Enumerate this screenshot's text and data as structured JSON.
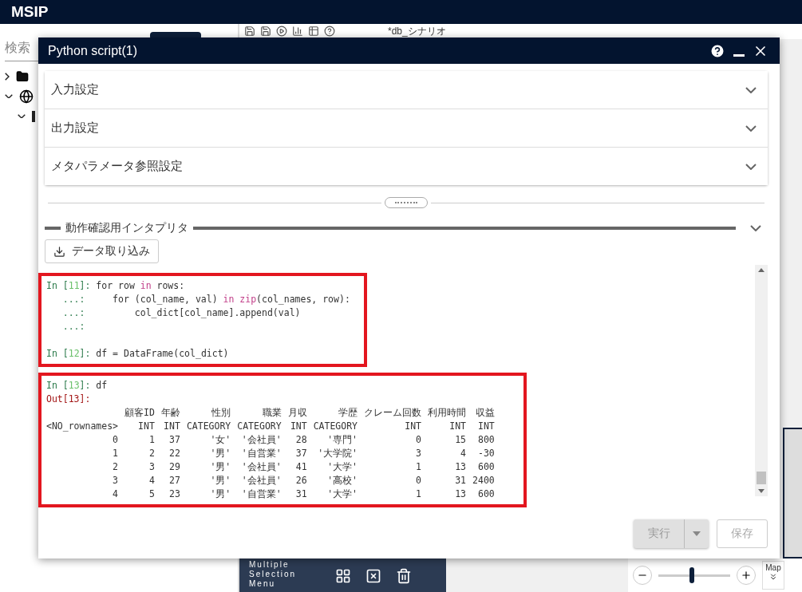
{
  "app": {
    "title": "MSIP"
  },
  "sidebar": {
    "search_label": "検索",
    "tree": [
      {
        "kind": "folder",
        "expanded": false
      },
      {
        "kind": "globe",
        "expanded": true,
        "children": [
          {
            "kind": "item",
            "expanded": true
          }
        ]
      }
    ]
  },
  "editor_tab": {
    "label": "*db_シナリオ"
  },
  "dialog": {
    "title": "Python script(1)",
    "sections": [
      {
        "label": "入力設定",
        "expanded": false
      },
      {
        "label": "出力設定",
        "expanded": false
      },
      {
        "label": "メタパラメータ参照設定",
        "expanded": false
      }
    ],
    "interpreter": {
      "title": "動作確認用インタプリタ",
      "import_button": "データ取り込み",
      "cells": [
        {
          "entries": [
            [
              [
                {
                  "text": "In [",
                  "kind": "prompt"
                },
                {
                  "text": "11",
                  "kind": "number"
                },
                {
                  "text": "]: ",
                  "kind": "prompt"
                },
                {
                  "text": "for row ",
                  "kind": "code"
                },
                {
                  "text": "in",
                  "kind": "keyword"
                },
                {
                  "text": " rows:",
                  "kind": "code"
                }
              ],
              [
                {
                  "text": "   ...: ",
                  "kind": "prompt"
                },
                {
                  "text": "    for (col_name, val) ",
                  "kind": "code"
                },
                {
                  "text": "in zip",
                  "kind": "keyword"
                },
                {
                  "text": "(col_names, row):",
                  "kind": "code"
                }
              ],
              [
                {
                  "text": "   ...: ",
                  "kind": "prompt"
                },
                {
                  "text": "        col_dict[col_name].append(val)",
                  "kind": "code"
                }
              ],
              [
                {
                  "text": "   ...: ",
                  "kind": "prompt"
                }
              ]
            ],
            [
              [
                {
                  "text": "In [",
                  "kind": "prompt"
                },
                {
                  "text": "12",
                  "kind": "number"
                },
                {
                  "text": "]: ",
                  "kind": "prompt"
                },
                {
                  "text": "df = DataFrame(col_dict)",
                  "kind": "code"
                }
              ]
            ]
          ]
        },
        {
          "entries": [
            [
              [
                {
                  "text": "In [",
                  "kind": "prompt"
                },
                {
                  "text": "13",
                  "kind": "number"
                },
                {
                  "text": "]: ",
                  "kind": "prompt"
                },
                {
                  "text": "df",
                  "kind": "code"
                }
              ],
              [
                {
                  "text": "Out[13]:",
                  "kind": "output"
                }
              ]
            ]
          ],
          "output": {
            "headers": [
              "顧客ID",
              "年齢",
              "性別",
              "職業",
              "月収",
              "学歴",
              "クレーム回数",
              "利用時間",
              "収益"
            ],
            "types": [
              "<NO_rownames>",
              "INT",
              "INT",
              "CATEGORY",
              "CATEGORY",
              "INT",
              "CATEGORY",
              "INT",
              "INT",
              "INT"
            ],
            "rows": [
              [
                "0",
                "1",
                "37",
                "'女'",
                "'会社員'",
                "28",
                "'専門'",
                "0",
                "15",
                "800"
              ],
              [
                "1",
                "2",
                "22",
                "'男'",
                "'自営業'",
                "37",
                "'大学院'",
                "3",
                "4",
                "-30"
              ],
              [
                "2",
                "3",
                "29",
                "'男'",
                "'会社員'",
                "41",
                "'大学'",
                "1",
                "13",
                "600"
              ],
              [
                "3",
                "4",
                "27",
                "'男'",
                "'会社員'",
                "26",
                "'高校'",
                "0",
                "31",
                "2400"
              ],
              [
                "4",
                "5",
                "23",
                "'男'",
                "'自営業'",
                "31",
                "'大学'",
                "1",
                "13",
                "600"
              ]
            ]
          }
        }
      ]
    },
    "buttons": [
      {
        "label": "実行",
        "kind": "split",
        "disabled": true
      },
      {
        "label": "保存",
        "kind": "plain",
        "disabled": true
      }
    ]
  },
  "selection_menu": {
    "label": "Multiple Selection Menu"
  },
  "zoom": {
    "level": 0.47
  },
  "map_button": {
    "label": "Map"
  }
}
